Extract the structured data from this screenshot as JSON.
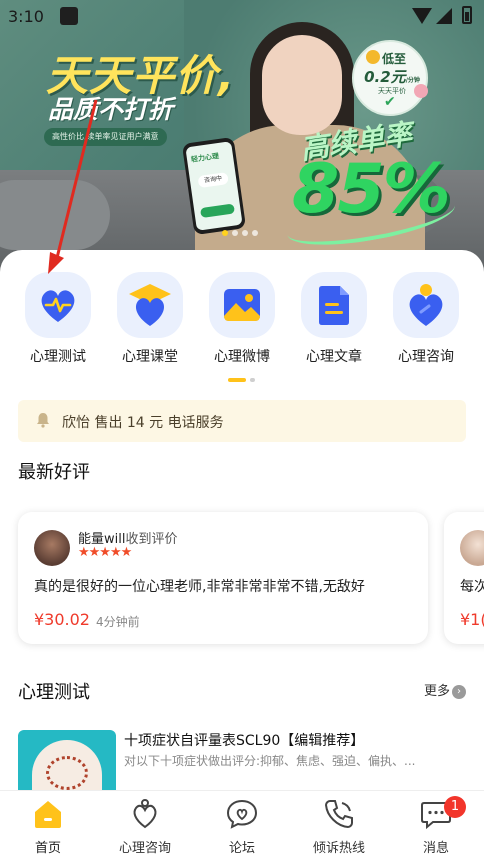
{
  "status_bar": {
    "time": "3:10"
  },
  "banner": {
    "title": "天天平价,",
    "subtitle": "品质不打折",
    "tagline": "高性价比,续单率见证用户满意",
    "badge_line1": "低至",
    "badge_price": "0.2元",
    "badge_unit": "/分钟",
    "badge_line3": "天天平价",
    "rate_label": "高续单率",
    "rate_value": "85%",
    "phone_app_name": "轻力心理",
    "phone_status": "咨询中",
    "carousel_dots": 4,
    "carousel_active": 0
  },
  "menu": {
    "items": [
      {
        "label": "心理测试",
        "icon": "heartbeat-icon"
      },
      {
        "label": "心理课堂",
        "icon": "graduation-heart-icon"
      },
      {
        "label": "心理微博",
        "icon": "image-icon"
      },
      {
        "label": "心理文章",
        "icon": "document-icon"
      },
      {
        "label": "心理咨询",
        "icon": "person-heart-icon"
      }
    ],
    "pages": 2,
    "active_page": 0
  },
  "notice": {
    "text": "欣怡 售出 14 元 电话服务",
    "icon": "bell-icon"
  },
  "reviews": {
    "title": "最新好评",
    "cards": [
      {
        "user": "能量will",
        "suffix": "收到评价",
        "stars": 5,
        "content": "真的是很好的一位心理老师,非常非常非常不错,无敌好",
        "price": "¥30.02",
        "time": "4分钟前"
      },
      {
        "content_partial": "每次",
        "price_partial": "¥1("
      }
    ]
  },
  "tests": {
    "title": "心理测试",
    "more_label": "更多",
    "items": [
      {
        "title": "十项症状自评量表SCL90【编辑推荐】",
        "desc": "对以下十项症状做出评分:抑郁、焦虑、强迫、偏执、..."
      }
    ]
  },
  "bottom_nav": {
    "items": [
      {
        "label": "首页",
        "icon": "home-icon",
        "active": true
      },
      {
        "label": "心理咨询",
        "icon": "heart-hand-icon"
      },
      {
        "label": "论坛",
        "icon": "chat-heart-icon"
      },
      {
        "label": "倾诉热线",
        "icon": "phone-icon"
      },
      {
        "label": "消息",
        "icon": "message-icon"
      }
    ],
    "unread_count": "1"
  },
  "colors": {
    "accent": "#ffc21a",
    "brand_blue": "#3a5ff0",
    "price_red": "#ef3a2b",
    "banner_green": "#4c7e73"
  }
}
